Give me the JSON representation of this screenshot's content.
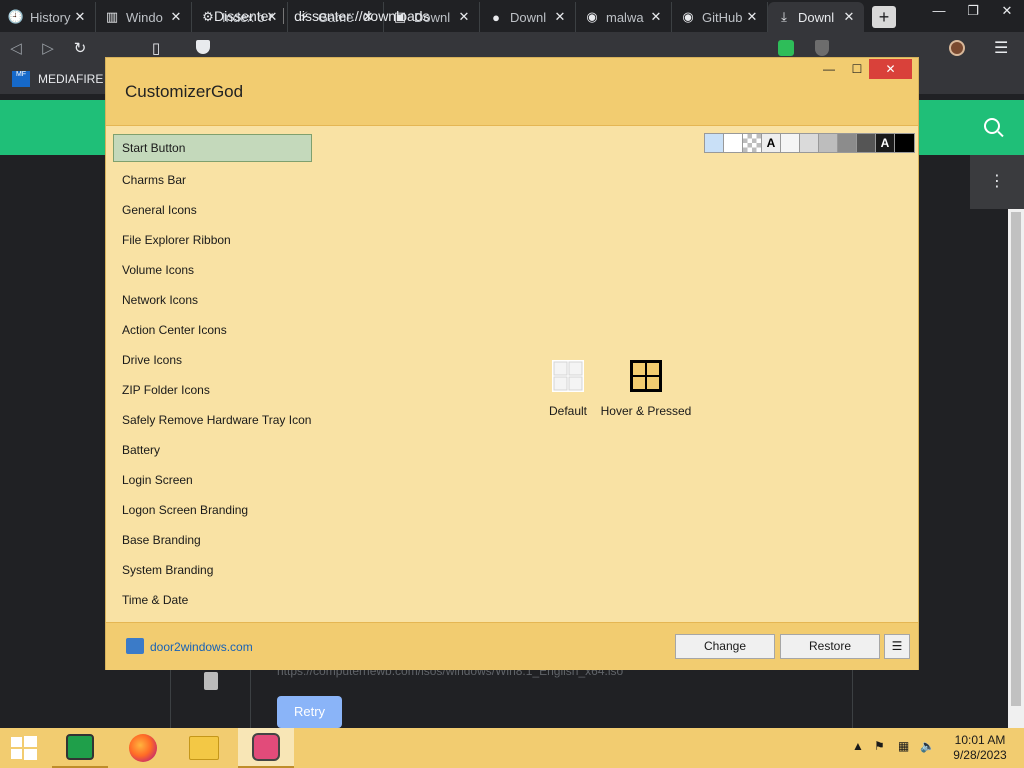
{
  "browser": {
    "tabs": [
      {
        "title": "History",
        "icon": "history-icon"
      },
      {
        "title": "Windo",
        "icon": "archive-icon"
      },
      {
        "title": "Index o",
        "icon": "folder-icon"
      },
      {
        "title": "Game",
        "icon": "game-icon"
      },
      {
        "title": "Downl",
        "icon": "download-site-icon"
      },
      {
        "title": "Downl",
        "icon": "globe-icon"
      },
      {
        "title": "malwa",
        "icon": "github-icon"
      },
      {
        "title": "GitHub",
        "icon": "github-icon"
      },
      {
        "title": "Downl",
        "icon": "download-icon",
        "active": true
      }
    ],
    "close_glyph": "✕",
    "new_tab": "+",
    "site_name": "Dissenter",
    "url": "dissenter://downloads",
    "bookmark": "MEDIAFIRE R"
  },
  "page": {
    "download_url": "https://computernewb.com/isos/windows/Win8.1_English_x64.iso",
    "retry_label": "Retry"
  },
  "app": {
    "title": "CustomizerGod",
    "sidebar": [
      "Start Button",
      "Charms Bar",
      "General Icons",
      "File Explorer Ribbon",
      "Volume Icons",
      "Network Icons",
      "Action Center Icons",
      "Drive Icons",
      "ZIP Folder Icons",
      "Safely Remove Hardware Tray Icon",
      "Battery",
      "Login Screen",
      "Logon Screen Branding",
      "Base Branding",
      "System Branding",
      "Time & Date"
    ],
    "selected_index": 0,
    "swatch_letter": "A",
    "preview_default": "Default",
    "preview_hover": "Hover & Pressed",
    "footer_link": "door2windows.com",
    "change_label": "Change",
    "restore_label": "Restore",
    "menu_glyph": "☰"
  },
  "taskbar": {
    "time": "10:01 AM",
    "date": "9/28/2023"
  },
  "colors": {
    "app_body": "#f9e2a4",
    "app_bar": "#f2cc70",
    "selection": "#c4d9bb",
    "page_header": "#1fbf78",
    "retry": "#8ab4f8",
    "swatches": [
      "#c9e0f7",
      "#ffffff",
      "#e8e8e8",
      "#eeeeee",
      "#f5f5f5",
      "#dadada",
      "#bdbdbd",
      "#8c8c8c",
      "#555555",
      "#1a1a1a",
      "#000000"
    ]
  }
}
